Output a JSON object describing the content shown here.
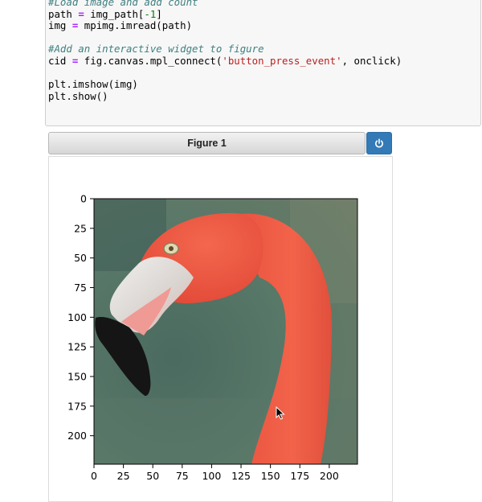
{
  "code": {
    "lines": [
      [
        {
          "t": "#Load image and add count",
          "c": "cm-comment"
        }
      ],
      [
        {
          "t": "path "
        },
        {
          "t": "=",
          "c": "cm-op"
        },
        {
          "t": " img_path["
        },
        {
          "t": "-1",
          "c": "cm-num"
        },
        {
          "t": "]"
        }
      ],
      [
        {
          "t": "img "
        },
        {
          "t": "=",
          "c": "cm-op"
        },
        {
          "t": " mpimg.imread(path)"
        }
      ],
      [
        {
          "t": ""
        }
      ],
      [
        {
          "t": "#Add an interactive widget to figure",
          "c": "cm-comment"
        }
      ],
      [
        {
          "t": "cid "
        },
        {
          "t": "=",
          "c": "cm-op"
        },
        {
          "t": " fig.canvas.mpl_connect("
        },
        {
          "t": "'button_press_event'",
          "c": "cm-str"
        },
        {
          "t": ", onclick)"
        }
      ],
      [
        {
          "t": ""
        }
      ],
      [
        {
          "t": "plt.imshow(img)"
        }
      ],
      [
        {
          "t": "plt.show()"
        }
      ]
    ]
  },
  "figure": {
    "title": "Figure 1",
    "power_button_icon": "power-icon"
  },
  "plot": {
    "image_description_icon": "flamingo-image",
    "x_ticks": [
      0,
      25,
      50,
      75,
      100,
      125,
      150,
      175,
      200
    ],
    "y_ticks": [
      0,
      25,
      50,
      75,
      100,
      125,
      150,
      175,
      200
    ],
    "x_range": [
      0,
      224
    ],
    "y_range": [
      0,
      224
    ]
  },
  "colors": {
    "flamingo": "#f0604a",
    "background_green": "#4f6e62",
    "beak_black": "#141414",
    "accent_blue": "#337ab7"
  }
}
